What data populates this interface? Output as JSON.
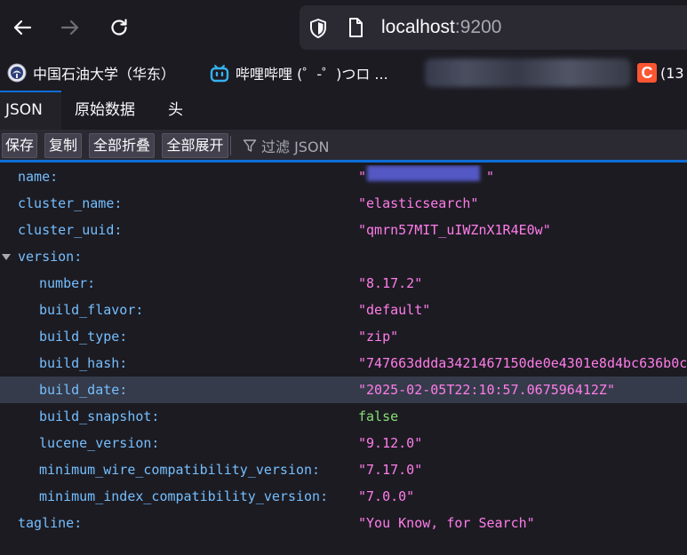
{
  "nav": {
    "back_icon": "arrow-left-icon",
    "forward_icon": "arrow-right-icon",
    "reload_icon": "reload-icon",
    "url_host": "localhost",
    "url_port": ":9200"
  },
  "bookmarks": [
    {
      "label": "中国石油大学（华东）",
      "icon": "upc-logo-icon"
    },
    {
      "label": "哔哩哔哩 (゜-゜)つロ ...",
      "icon": "bilibili-icon"
    },
    {
      "label": "(13",
      "icon": "csdn-icon",
      "icon_text": "C"
    }
  ],
  "viewer_tabs": [
    "JSON",
    "原始数据",
    "头"
  ],
  "toolbar": {
    "save": "保存",
    "copy": "复制",
    "collapse_all": "全部折叠",
    "expand_all": "全部展开",
    "filter_placeholder": "过滤 JSON"
  },
  "json_rows": [
    {
      "key": "name:",
      "value": "\"",
      "value_end": "\"",
      "type": "string"
    },
    {
      "key": "cluster_name:",
      "value": "\"elasticsearch\"",
      "type": "string"
    },
    {
      "key": "cluster_uuid:",
      "value": "\"qmrn57MIT_uIWZnX1R4E0w\"",
      "type": "string"
    },
    {
      "key": "version:",
      "value": "",
      "type": "object"
    },
    {
      "key": "number:",
      "value": "\"8.17.2\"",
      "type": "string"
    },
    {
      "key": "build_flavor:",
      "value": "\"default\"",
      "type": "string"
    },
    {
      "key": "build_type:",
      "value": "\"zip\"",
      "type": "string"
    },
    {
      "key": "build_hash:",
      "value": "\"747663ddda3421467150de0e4301e8d4bc636b0c",
      "type": "string"
    },
    {
      "key": "build_date:",
      "value": "\"2025-02-05T22:10:57.067596412Z\"",
      "type": "string"
    },
    {
      "key": "build_snapshot:",
      "value": "false",
      "type": "boolean"
    },
    {
      "key": "lucene_version:",
      "value": "\"9.12.0\"",
      "type": "string"
    },
    {
      "key": "minimum_wire_compatibility_version:",
      "value": "\"7.17.0\"",
      "type": "string"
    },
    {
      "key": "minimum_index_compatibility_version:",
      "value": "\"7.0.0\"",
      "type": "string"
    },
    {
      "key": "tagline:",
      "value": "\"You Know, for Search\"",
      "type": "string"
    }
  ],
  "colors": {
    "key": "#75bfff",
    "string": "#ff7de9",
    "boolean": "#86de74",
    "accent": "#0e6ed9",
    "highlight_row": "#353b4a"
  }
}
